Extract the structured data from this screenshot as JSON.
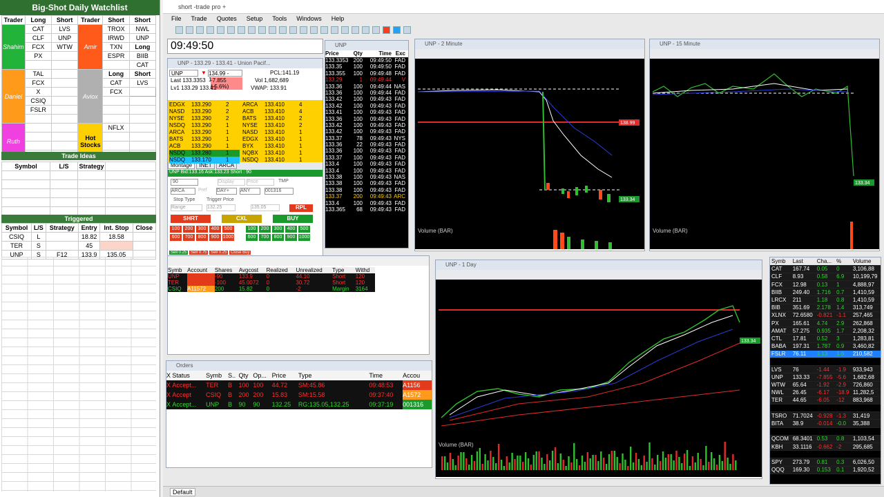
{
  "spreadsheet": {
    "title": "Big-Shot Daily Watchlist",
    "headers": [
      "Trader",
      "Long",
      "Short",
      "Trader",
      "Short",
      "Short"
    ],
    "rows": [
      [
        "CAT",
        "LVS",
        "",
        "TROX",
        "NWL"
      ],
      [
        "CLF",
        "UNP",
        "",
        "IRWD",
        "UNP"
      ],
      [
        "FCX",
        "WTW",
        "",
        "TXN",
        "Long"
      ],
      [
        "PX",
        "",
        "",
        "ESPR",
        "BIIB"
      ],
      [
        "",
        "",
        "",
        "",
        "CAT"
      ]
    ],
    "mid_headers": [
      "Long",
      "Short"
    ],
    "mid_rows": [
      [
        "TAL",
        "",
        "CAT",
        "LVS"
      ],
      [
        "FCX",
        "",
        "FCX",
        ""
      ],
      [
        "X",
        "",
        "",
        ""
      ],
      [
        "CSIQ",
        "",
        "",
        ""
      ],
      [
        "FSLR",
        "",
        "",
        ""
      ],
      [
        "",
        "",
        "NFLX",
        ""
      ]
    ],
    "trader_names": [
      "Shahim",
      "Amir",
      "Daniel",
      "Aviox",
      "Ruth"
    ],
    "hot_stocks": "Hot Stocks",
    "trade_ideas_title": "Trade Ideas",
    "ideas_headers": [
      "Symbol",
      "L/S",
      "Strategy"
    ],
    "triggered_title": "Triggered",
    "trig_headers": [
      "Symbol",
      "L/S",
      "Strategy",
      "Entry",
      "Int. Stop",
      "Close"
    ],
    "trig_rows": [
      [
        "CSIQ",
        "L",
        "",
        "18.82",
        "18.58",
        ""
      ],
      [
        "TER",
        "S",
        "",
        "45",
        "",
        ""
      ],
      [
        "UNP",
        "S",
        "F12",
        "133.9",
        "135.05",
        ""
      ]
    ]
  },
  "app": {
    "title": "short -trade pro +",
    "menu": [
      "File",
      "Trade",
      "Quotes",
      "Setup",
      "Tools",
      "Windows",
      "Help"
    ],
    "clock": "09:49:50",
    "footer_tab": "Default"
  },
  "montage": {
    "title": "UNP - 133.29 - 133.41 - Union Pacif...",
    "symbol": "UNP",
    "bidask": "134.99 - 132.49",
    "pcl": "PCL:141.19",
    "last": "Last 133.3353",
    "chg": "-7.855 (-5.6%)",
    "vol": "Vol 1,682,689",
    "lv1": "Lv1 133.29 133.41",
    "vwap": "VWAP: 133.91",
    "bids": [
      [
        "EDGX",
        "133.290",
        "2"
      ],
      [
        "NASD",
        "133.290",
        "2"
      ],
      [
        "NYSE",
        "133.290",
        "2"
      ],
      [
        "NSDQ",
        "133.290",
        "1"
      ],
      [
        "ARCA",
        "133.290",
        "1"
      ],
      [
        "BATS",
        "133.290",
        "1"
      ],
      [
        "ACB",
        "133.290",
        "1"
      ],
      [
        "NSDQ",
        "133.280",
        "1"
      ],
      [
        "NSDQ",
        "133.170",
        "1"
      ]
    ],
    "asks": [
      [
        "ARCA",
        "133.410",
        "4"
      ],
      [
        "ACB",
        "133.410",
        "4"
      ],
      [
        "BATS",
        "133.410",
        "2"
      ],
      [
        "NYSE",
        "133.410",
        "2"
      ],
      [
        "NASD",
        "133.410",
        "1"
      ],
      [
        "EDGX",
        "133.410",
        "1"
      ],
      [
        "BYX",
        "133.410",
        "1"
      ],
      [
        "NQBX",
        "133.410",
        "1"
      ],
      [
        "NSDQ",
        "133.410",
        "1"
      ]
    ],
    "tabs": [
      "Montage",
      "INET",
      "ARCA"
    ],
    "bidask_line": "UNP Bid:133.16 Ask:133.23",
    "short_line": "Short : 90",
    "qty": "90",
    "route": "ARCA",
    "tif": "DAY+",
    "any": "ANY",
    "acct": "001316",
    "tmp": "TMP",
    "stop_type": "Stop Type",
    "trigger_price": "Trigger Price",
    "range": "Range",
    "trig_val1": "132.25",
    "trig_val2": "135.05",
    "rpl": "RPL",
    "shrt": "SHRT",
    "cxl": "CXL",
    "buy": "BUY",
    "sizes_red": [
      "100",
      "200",
      "300",
      "400",
      "500",
      "600",
      "700",
      "800",
      "900",
      "1000"
    ],
    "sizes_green": [
      "100",
      "200",
      "300",
      "400",
      "500",
      "600",
      "700",
      "800",
      "900",
      "1000"
    ],
    "small_btns": [
      "Sell 0.25",
      "Sell 0.75",
      "Sell 0.25",
      "Close Buy"
    ],
    "display_lbl": "Display",
    "price_lbl": "Price",
    "pref_lbl": "Pref"
  },
  "tns": {
    "title": "UNP",
    "headers": [
      "Price",
      "Qty",
      "Time",
      "Exc"
    ],
    "rows": [
      [
        "133.3353",
        "200",
        "09:49:50",
        "FAD",
        "#fff"
      ],
      [
        "133.35",
        "100",
        "09:49:50",
        "FAD",
        "#fff"
      ],
      [
        "133.355",
        "100",
        "09:49:48",
        "FAD",
        "#fff"
      ],
      [
        "133.29",
        "1",
        "09:49:44",
        "V",
        "#ff3030"
      ],
      [
        "133.36",
        "100",
        "09:49:44",
        "NAS",
        "#fff"
      ],
      [
        "133.36",
        "100",
        "09:49:44",
        "FAD",
        "#fff"
      ],
      [
        "133.42",
        "100",
        "09:49:43",
        "FAD",
        "#fff"
      ],
      [
        "133.42",
        "100",
        "09:49:43",
        "FAD",
        "#fff"
      ],
      [
        "133.41",
        "100",
        "09:49:43",
        "FAD",
        "#fff"
      ],
      [
        "133.36",
        "100",
        "09:49:43",
        "FAD",
        "#fff"
      ],
      [
        "133.42",
        "100",
        "09:49:43",
        "FAD",
        "#fff"
      ],
      [
        "133.42",
        "100",
        "09:49:43",
        "FAD",
        "#fff"
      ],
      [
        "133.37",
        "78",
        "09:49:43",
        "NYS",
        "#fff"
      ],
      [
        "133.36",
        "22",
        "09:49:43",
        "FAD",
        "#fff"
      ],
      [
        "133.36",
        "100",
        "09:49:43",
        "FAD",
        "#fff"
      ],
      [
        "133.37",
        "100",
        "09:49:43",
        "FAD",
        "#fff"
      ],
      [
        "133.4",
        "100",
        "09:49:43",
        "FAD",
        "#fff"
      ],
      [
        "133.4",
        "100",
        "09:49:43",
        "FAD",
        "#fff"
      ],
      [
        "133.38",
        "100",
        "09:49:43",
        "NAS",
        "#fff"
      ],
      [
        "133.38",
        "100",
        "09:49:43",
        "FAD",
        "#fff"
      ],
      [
        "133.38",
        "100",
        "09:49:43",
        "FAD",
        "#fff"
      ],
      [
        "133.37",
        "200",
        "09:49:43",
        "ARC",
        "#ffd000"
      ],
      [
        "133.4",
        "100",
        "09:49:43",
        "FAD",
        "#fff"
      ],
      [
        "133.365",
        "68",
        "09:49:43",
        "FAD",
        "#fff"
      ]
    ]
  },
  "positions": {
    "headers": [
      "Symb",
      "Account",
      "Shares",
      "Avgcost",
      "Realized",
      "Unrealized",
      "Type",
      "Withd"
    ],
    "rows": [
      [
        "UNP",
        "",
        "-90",
        "133.9",
        "0",
        "44.10",
        "Short",
        "120"
      ],
      [
        "TER",
        "",
        "-100",
        "45.0072",
        "0",
        "30.72",
        "Short",
        "120"
      ],
      [
        "CSIQ",
        "A11572",
        "200",
        "15.82",
        "0",
        "-2",
        "Margin",
        "3164"
      ]
    ]
  },
  "orders": {
    "title": "Orders",
    "headers": [
      "X",
      "Status",
      "Symb",
      "S..",
      "Qty",
      "Op...",
      "Price",
      "Type",
      "Time",
      "Accou"
    ],
    "rows": [
      [
        "X",
        "Accept...",
        "TER",
        "B",
        "100",
        "100",
        "44.72",
        "SM:45.86",
        "09:48:53",
        "A1156"
      ],
      [
        "X",
        "Accept",
        "CSIQ",
        "B",
        "200",
        "200",
        "15.83",
        "SM:15.58",
        "09:37:40",
        "A1572"
      ],
      [
        "X",
        "Accept...",
        "UNP",
        "B",
        "90",
        "90",
        "132.25",
        "RG:135.05,132.25",
        "09:37:19",
        "001316"
      ]
    ]
  },
  "charts": {
    "c2m_title": "UNP - 2 Minute",
    "c15m_title": "UNP - 15 Minute",
    "c1d_title": "UNP - 1 Day",
    "volume_label": "Volume (BAR)",
    "price_tag": "133.34",
    "price_tag2": "133.34",
    "price_tag3": "133.34",
    "level_tag": "138.99"
  },
  "watchlist": {
    "headers": [
      "Symb",
      "Last",
      "Cha...",
      "%",
      "Volume"
    ],
    "rows": [
      [
        "CAT",
        "167.74",
        "0.05",
        "0",
        "3,106,88",
        "#1a1a1a"
      ],
      [
        "CLF",
        "8.93",
        "0.58",
        "6.9",
        "10,199,79",
        "#1a1a1a"
      ],
      [
        "FCX",
        "12.98",
        "0.13",
        "1",
        "4,888,97",
        "#1a1a1a"
      ],
      [
        "BIIB",
        "249.40",
        "1.716",
        "0.7",
        "1,410,59",
        "#1a1a1a"
      ],
      [
        "LRCX",
        "211",
        "1.18",
        "0.8",
        "1,410,59",
        "#1a1a1a"
      ],
      [
        "BIB",
        "351.69",
        "2.178",
        "1.4",
        "313,749",
        "#1a1a1a"
      ],
      [
        "XLNX",
        "72.6580",
        "-0.821",
        "-1.1",
        "257,465",
        "#1a1a1a"
      ],
      [
        "PX",
        "165.61",
        "4.74",
        "2.9",
        "262,868",
        "#1a1a1a"
      ],
      [
        "AMAT",
        "57.275",
        "0.935",
        "1.7",
        "2,208,32",
        "#1a1a1a"
      ],
      [
        "CTL",
        "17.81",
        "0.52",
        "3",
        "1,283,81",
        "#1a1a1a"
      ],
      [
        "BABA",
        "197.31",
        "1.787",
        "0.9",
        "3,460,82",
        "#1a1a1a"
      ],
      [
        "FSLR",
        "76.11",
        "1.13",
        "1.6",
        "210,582",
        "#1e7fff"
      ],
      [
        "",
        "",
        "",
        "",
        "",
        ""
      ],
      [
        "LVS",
        "76",
        "-1.44",
        "-1.9",
        "933,943",
        "#1a1a1a"
      ],
      [
        "UNP",
        "133.33",
        "-7.855",
        "-5.6",
        "1,682,68",
        "#1a1a1a"
      ],
      [
        "WTW",
        "65.64",
        "-1.92",
        "-2.9",
        "726,860",
        "#1a1a1a"
      ],
      [
        "NWL",
        "26.45",
        "-6.17",
        "-18.9",
        "11,282,5",
        "#1a1a1a"
      ],
      [
        "TER",
        "44.65",
        "-6.05",
        "-12",
        "883,968",
        "#1a1a1a"
      ],
      [
        "",
        "",
        "",
        "",
        "",
        ""
      ],
      [
        "TSRO",
        "71.7024",
        "-0.928",
        "-1.3",
        "31,419",
        "#1a1a1a"
      ],
      [
        "BITA",
        "38.9",
        "-0.014",
        "-0.0",
        "35,388",
        "#1a1a1a"
      ],
      [
        "",
        "",
        "",
        "",
        "",
        ""
      ],
      [
        "QCOM",
        "68.3401",
        "0.53",
        "0.8",
        "1,103,54",
        "#1a1a1a"
      ],
      [
        "KBH",
        "33.1116",
        "-0.662",
        "-2",
        "295,685",
        "#1a1a1a"
      ],
      [
        "",
        "",
        "",
        "",
        "",
        ""
      ],
      [
        "SPY",
        "273.79",
        "0.81",
        "0.3",
        "6,026,50",
        "#1a1a1a"
      ],
      [
        "QQQ",
        "169.30",
        "0.153",
        "0.1",
        "1,920,52",
        "#1a1a1a"
      ]
    ]
  }
}
